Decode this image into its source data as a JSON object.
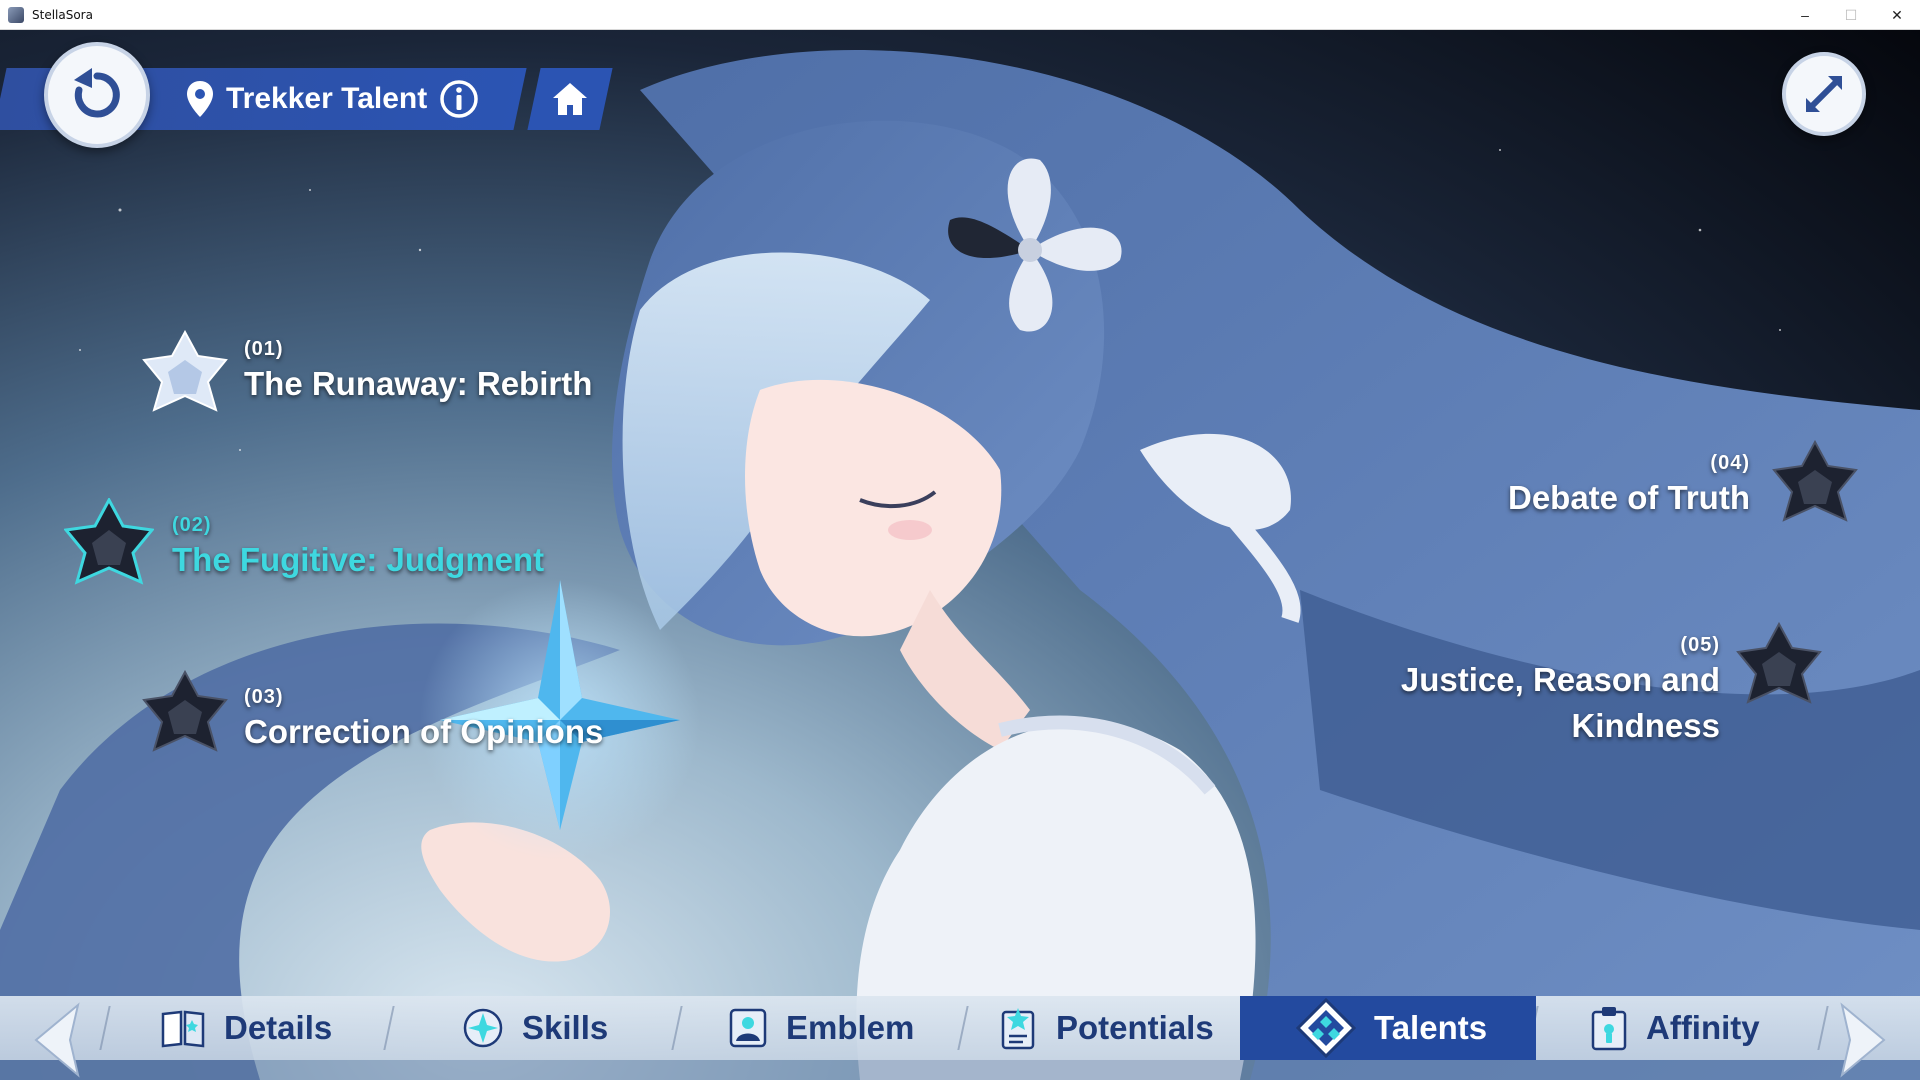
{
  "window": {
    "title": "StellaSora",
    "controls": {
      "minimize": "–",
      "maximize": "☐",
      "close": "✕"
    }
  },
  "header": {
    "title": "Trekker Talent"
  },
  "talents": [
    {
      "num": "(01)",
      "name": "The Runaway: Rebirth",
      "state": "unlocked"
    },
    {
      "num": "(02)",
      "name": "The Fugitive: Judgment",
      "state": "selected"
    },
    {
      "num": "(03)",
      "name": "Correction of Opinions",
      "state": "locked"
    },
    {
      "num": "(04)",
      "name": "Debate of Truth",
      "state": "locked"
    },
    {
      "num": "(05)",
      "name_line1": "Justice, Reason and",
      "name_line2": "Kindness",
      "state": "locked"
    }
  ],
  "bottom_nav": {
    "tabs": [
      {
        "label": "Details",
        "icon": "book-icon"
      },
      {
        "label": "Skills",
        "icon": "star-badge-icon"
      },
      {
        "label": "Emblem",
        "icon": "portrait-icon"
      },
      {
        "label": "Potentials",
        "icon": "card-icon"
      },
      {
        "label": "Talents",
        "icon": "diamond-icon",
        "active": true
      },
      {
        "label": "Affinity",
        "icon": "clipboard-icon"
      }
    ]
  },
  "colors": {
    "accent_blue": "#2b54b3",
    "active_talent": "#3ed8e0",
    "nav_text": "#1e3a78"
  }
}
